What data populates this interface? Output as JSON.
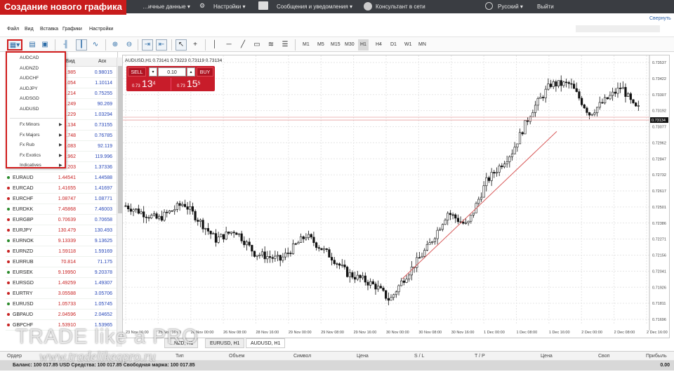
{
  "caption": "Создание нового графика",
  "topbar": {
    "items": [
      {
        "label": "…ичные данные ▾"
      },
      {
        "label": "Настройки ▾"
      },
      {
        "label": "Сообщения и уведомления ▾"
      },
      {
        "label": "Консультант в сети"
      },
      {
        "label": "Русский ▾"
      },
      {
        "label": "Выйти"
      }
    ],
    "collapse": "Свернуть"
  },
  "menu": [
    "Файл",
    "Вид",
    "Вставка",
    "Графики",
    "Настройки"
  ],
  "timeframes": [
    "M1",
    "M5",
    "M15",
    "M30",
    "H1",
    "H4",
    "D1",
    "W1",
    "MN"
  ],
  "active_timeframe": "H1",
  "market_watch": {
    "headers": {
      "bid": "Бид",
      "ask": "Аск"
    },
    "hidden_rows": [
      {
        "bid": ".985",
        "ask": "0.98015"
      },
      {
        "bid": ".054",
        "ask": "1.10114"
      },
      {
        "bid": ".214",
        "ask": "0.75255"
      },
      {
        "bid": ".249",
        "ask": "90.269"
      },
      {
        "bid": ".229",
        "ask": "1.03294"
      },
      {
        "bid": ".134",
        "ask": "0.73155"
      },
      {
        "bid": ".748",
        "ask": "0.76785"
      },
      {
        "bid": ".083",
        "ask": "92.119"
      },
      {
        "bid": ".962",
        "ask": "119.996"
      },
      {
        "bid": ".203",
        "ask": "1.37336"
      }
    ],
    "rows": [
      {
        "symbol": "EURAUD",
        "bid": "1.44541",
        "ask": "1.44588"
      },
      {
        "symbol": "EURCAD",
        "bid": "1.41655",
        "ask": "1.41697"
      },
      {
        "symbol": "EURCHF",
        "bid": "1.08747",
        "ask": "1.08771"
      },
      {
        "symbol": "EURDKK",
        "bid": "7.45868",
        "ask": "7.46003"
      },
      {
        "symbol": "EURGBP",
        "bid": "0.70639",
        "ask": "0.70658"
      },
      {
        "symbol": "EURJPY",
        "bid": "130.479",
        "ask": "130.493"
      },
      {
        "symbol": "EURNOK",
        "bid": "9.13339",
        "ask": "9.13625"
      },
      {
        "symbol": "EURNZD",
        "bid": "1.59118",
        "ask": "1.59169"
      },
      {
        "symbol": "EURRUB",
        "bid": "70.814",
        "ask": "71.175"
      },
      {
        "symbol": "EURSEK",
        "bid": "9.19950",
        "ask": "9.20378"
      },
      {
        "symbol": "EURSGD",
        "bid": "1.49259",
        "ask": "1.49307"
      },
      {
        "symbol": "EURTRY",
        "bid": "3.05588",
        "ask": "3.05706"
      },
      {
        "symbol": "EURUSD",
        "bid": "1.05733",
        "ask": "1.05745"
      },
      {
        "symbol": "GBPAUD",
        "bid": "2.04596",
        "ask": "2.04652"
      },
      {
        "symbol": "GBPCHF",
        "bid": "1.53910",
        "ask": "1.53965"
      }
    ]
  },
  "dropdown": {
    "symbols": [
      "AUDCAD",
      "AUDNZD",
      "AUDCHF",
      "AUDJPY",
      "AUDSGD",
      "AUDUSD"
    ],
    "groups": [
      "Fx Minors",
      "Fx Majors",
      "Fx Rub",
      "Fx Exotics",
      "Indicatives"
    ]
  },
  "chart": {
    "header": "AUDUSD,H1  0.73141 0.73223 0.73119 0.73134",
    "sell": "SELL",
    "buy": "BUY",
    "volume": "0.10",
    "sell_price": {
      "small": "0.73",
      "big": "13",
      "sup": "4"
    },
    "buy_price": {
      "small": "0.73",
      "big": "15",
      "sup": "5"
    },
    "current_price": "0.73134",
    "y_ticks": [
      "0.73537",
      "0.73422",
      "0.73307",
      "0.73192",
      "0.73077",
      "0.72962",
      "0.72847",
      "0.72732",
      "0.72617",
      "0.72501",
      "0.72386",
      "0.72271",
      "0.72156",
      "0.72041",
      "0.71926",
      "0.71811",
      "0.71696"
    ],
    "x_ticks": [
      "23 Nov 16:00",
      "25 Nov 16:00",
      "26 Nov 00:00",
      "26 Nov 08:00",
      "28 Nov 16:00",
      "29 Nov 00:00",
      "29 Nov 08:00",
      "29 Nov 16:00",
      "30 Nov 00:00",
      "30 Nov 08:00",
      "30 Nov 16:00",
      "1 Dec 00:00",
      "1 Dec 08:00",
      "1 Dec 16:00",
      "2 Dec 00:00",
      "2 Dec 08:00",
      "2 Dec 16:00"
    ]
  },
  "tabs": [
    "…NZD, H1",
    "EURUSD, H1",
    "AUDUSD, H1"
  ],
  "active_tab": "AUDUSD, H1",
  "orders_headers": [
    "Ордер",
    "Тип",
    "Объем",
    "Символ",
    "Цена",
    "S / L",
    "T / P",
    "Цена",
    "Своп",
    "Прибыль"
  ],
  "balance_line": "Баланс: 100 017.85 USD  Средства: 100 017.85  Свободная маржа: 100 017.85",
  "profit_total": "0.00",
  "watermark": {
    "brand": "TRADE like a PRO",
    "site": "www.tradelikeapro.ru"
  }
}
